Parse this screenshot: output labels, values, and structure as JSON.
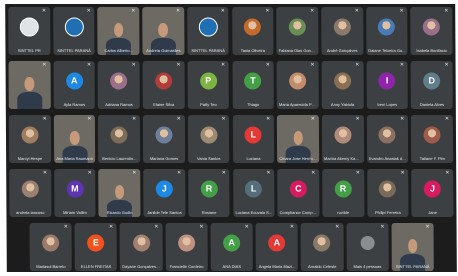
{
  "meeting": {
    "rows": [
      {
        "tiles": [
          {
            "name": "SINTTEL PR",
            "avatar": "",
            "color": "#dfe3e8",
            "kind": "logo"
          },
          {
            "name": "SINTTEL PARANÁ",
            "avatar": "",
            "color": "#1f6fb5",
            "kind": "logo"
          },
          {
            "name": "Carlos Alberto...",
            "avatar": "",
            "color": "",
            "kind": "photo"
          },
          {
            "name": "Andreia Guimarães",
            "avatar": "",
            "color": "",
            "kind": "photo"
          },
          {
            "name": "SINTTEL PARANÁ",
            "avatar": "",
            "color": "#1f6fb5",
            "kind": "logo"
          },
          {
            "name": "Tania Oliveira",
            "avatar": "",
            "color": "#c46a2b",
            "kind": "img"
          },
          {
            "name": "Fabiana Dias Gong...",
            "avatar": "",
            "color": "#6a8f55",
            "kind": "img"
          },
          {
            "name": "André Gonçalves",
            "avatar": "",
            "color": "#8b7a6a",
            "kind": "img"
          },
          {
            "name": "Daiane Teixeira Go...",
            "avatar": "",
            "color": "#4a7bb7",
            "kind": "img"
          },
          {
            "name": "Isabela Bonifacio",
            "avatar": "",
            "color": "#9a6f8a",
            "kind": "img"
          }
        ]
      },
      {
        "tiles": [
          {
            "name": "",
            "avatar": "",
            "color": "",
            "kind": "photo"
          },
          {
            "name": "Ayla Ramos",
            "avatar": "A",
            "color": "#1e88e5",
            "kind": "letter"
          },
          {
            "name": "Adriana Ramos",
            "avatar": "",
            "color": "#9a6f8a",
            "kind": "img"
          },
          {
            "name": "Elaine Silva",
            "avatar": "",
            "color": "#b23b3b",
            "kind": "img"
          },
          {
            "name": "Patty Teo",
            "avatar": "P",
            "color": "#7cb342",
            "kind": "letter"
          },
          {
            "name": "Thiago",
            "avatar": "T",
            "color": "#43a047",
            "kind": "letter"
          },
          {
            "name": "Maria Aparecida Pe...",
            "avatar": "",
            "color": "#c28b6a",
            "kind": "img"
          },
          {
            "name": "Anny Yabiola",
            "avatar": "",
            "color": "#8a6f55",
            "kind": "img"
          },
          {
            "name": "Ireni Lopes",
            "avatar": "I",
            "color": "#8e24aa",
            "kind": "letter"
          },
          {
            "name": "Daniela Alves",
            "avatar": "D",
            "color": "#607d8b",
            "kind": "letter"
          }
        ]
      },
      {
        "tiles": [
          {
            "name": "Marcyi Hespe",
            "avatar": "",
            "color": "#a07d5e",
            "kind": "img"
          },
          {
            "name": "Ana Maria Raumann",
            "avatar": "",
            "color": "",
            "kind": "photo"
          },
          {
            "name": "Benicio Laurentin...",
            "avatar": "",
            "color": "#7c6c5a",
            "kind": "img"
          },
          {
            "name": "Mariana Gomes",
            "avatar": "",
            "color": "#6d7f9a",
            "kind": "img"
          },
          {
            "name": "Vania Santos",
            "avatar": "",
            "color": "#9c8a72",
            "kind": "img"
          },
          {
            "name": "Luciana",
            "avatar": "L",
            "color": "#e53935",
            "kind": "letter"
          },
          {
            "name": "Cinara Jose Herrma...",
            "avatar": "",
            "color": "",
            "kind": "photo"
          },
          {
            "name": "Marina Akemy Kam...",
            "avatar": "",
            "color": "#b08a7a",
            "kind": "img"
          },
          {
            "name": "Evandro Anasiak da...",
            "avatar": "",
            "color": "#8a7060",
            "kind": "img"
          },
          {
            "name": "Tatiane F. Pim",
            "avatar": "",
            "color": "#a05a4a",
            "kind": "img"
          }
        ]
      },
      {
        "tiles": [
          {
            "name": "andreia iancoso",
            "avatar": "",
            "color": "#9a8070",
            "kind": "img"
          },
          {
            "name": "Miriam Vallim",
            "avatar": "M",
            "color": "#5e35b1",
            "kind": "letter"
          },
          {
            "name": "Ricardo Godin",
            "avatar": "",
            "color": "",
            "kind": "photo"
          },
          {
            "name": "Janilde Tele Santos",
            "avatar": "J",
            "color": "#1e88e5",
            "kind": "letter"
          },
          {
            "name": "Rosiane",
            "avatar": "R",
            "color": "#43a047",
            "kind": "letter"
          },
          {
            "name": "Luciana Eouvala S...",
            "avatar": "L",
            "color": "#546e7a",
            "kind": "letter"
          },
          {
            "name": "Compliance Compli...",
            "avatar": "C",
            "color": "#d81b60",
            "kind": "letter"
          },
          {
            "name": "ruvilde",
            "avatar": "R",
            "color": "#43a047",
            "kind": "letter"
          },
          {
            "name": "Philipi Ferreira",
            "avatar": "",
            "color": "#7a6a5a",
            "kind": "img"
          },
          {
            "name": "Jane",
            "avatar": "J",
            "color": "#d81b60",
            "kind": "letter"
          }
        ]
      },
      {
        "tiles": [
          {
            "name": "Mariasol Barreto",
            "avatar": "",
            "color": "#9a7a6a",
            "kind": "img"
          },
          {
            "name": "ELLEN FREITAS",
            "avatar": "E",
            "color": "#f4511e",
            "kind": "letter"
          },
          {
            "name": "Dayane Gonçalves ...",
            "avatar": "",
            "color": "#a08070",
            "kind": "img"
          },
          {
            "name": "Francielle Cordeiro",
            "avatar": "",
            "color": "#c09080",
            "kind": "img"
          },
          {
            "name": "ANA DIAS",
            "avatar": "A",
            "color": "#43a047",
            "kind": "letter"
          },
          {
            "name": "Angela Maria Mazi...",
            "avatar": "A",
            "color": "#e53935",
            "kind": "letter"
          },
          {
            "name": "Arnaldo Celeste",
            "avatar": "",
            "color": "#8a7a6a",
            "kind": "img"
          },
          {
            "name": "Mais 4 pessoas",
            "avatar": "",
            "color": "#5f6368",
            "kind": "more"
          },
          {
            "name": "SINTTEL PARANÁ",
            "avatar": "",
            "color": "",
            "kind": "photo"
          }
        ]
      }
    ]
  }
}
